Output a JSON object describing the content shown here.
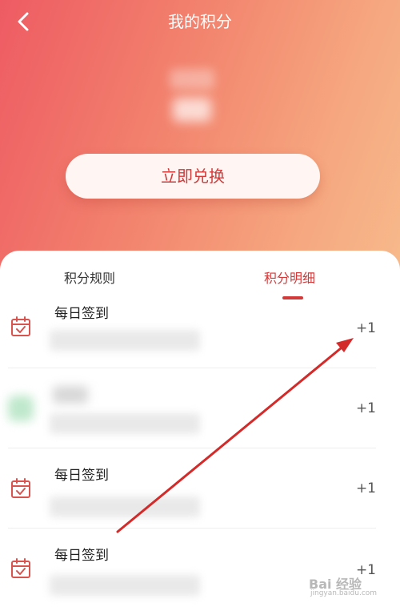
{
  "header": {
    "title": "我的积分",
    "back_icon": "chevron-left-icon",
    "redeem_label": "立即兑换"
  },
  "tabs": [
    {
      "label": "积分规则",
      "active": false
    },
    {
      "label": "积分明细",
      "active": true
    }
  ],
  "records": [
    {
      "title": "每日签到",
      "points": "+1",
      "icon": "calendar-check-icon"
    },
    {
      "title": "",
      "points": "+1",
      "icon": "blurred-app-icon"
    },
    {
      "title": "每日签到",
      "points": "+1",
      "icon": "calendar-check-icon"
    },
    {
      "title": "每日签到",
      "points": "+1",
      "icon": "calendar-check-icon"
    }
  ],
  "watermark": {
    "main": "Bai 经验",
    "sub": "jingyan.baidu.com"
  },
  "colors": {
    "accent": "#d23a3a",
    "header_gradient_start": "#ee5b63",
    "header_gradient_end": "#f7bb8c",
    "annotation_arrow": "#d32a2a"
  }
}
